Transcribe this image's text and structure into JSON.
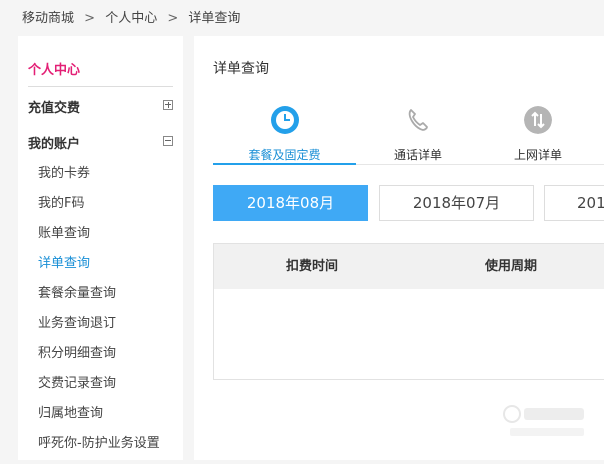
{
  "breadcrumb": [
    "移动商城",
    "个人中心",
    "详单查询"
  ],
  "breadcrumb_sep": ">",
  "sidebar": {
    "title": "个人中心",
    "groups": [
      {
        "label": "充值交费",
        "state": "collapsed"
      },
      {
        "label": "我的账户",
        "state": "expanded"
      }
    ],
    "items": [
      {
        "label": "我的卡券"
      },
      {
        "label": "我的F码"
      },
      {
        "label": "账单查询"
      },
      {
        "label": "详单查询",
        "active": true
      },
      {
        "label": "套餐余量查询"
      },
      {
        "label": "业务查询退订"
      },
      {
        "label": "积分明细查询"
      },
      {
        "label": "交费记录查询"
      },
      {
        "label": "归属地查询"
      },
      {
        "label": "呼死你-防护业务设置"
      }
    ]
  },
  "main": {
    "title": "详单查询",
    "tabs": [
      {
        "label": "套餐及固定费",
        "icon": "clock-icon",
        "active": true
      },
      {
        "label": "通话详单",
        "icon": "phone-icon"
      },
      {
        "label": "上网详单",
        "icon": "data-arrows-icon"
      }
    ],
    "months": [
      {
        "label": "2018年08月",
        "active": true
      },
      {
        "label": "2018年07月"
      },
      {
        "label": "201"
      }
    ],
    "table": {
      "columns": [
        "扣费时间",
        "使用周期"
      ]
    }
  },
  "colors": {
    "accent_pink": "#e31f75",
    "accent_blue": "#1a8fd6",
    "button_active": "#3fa9f5"
  }
}
